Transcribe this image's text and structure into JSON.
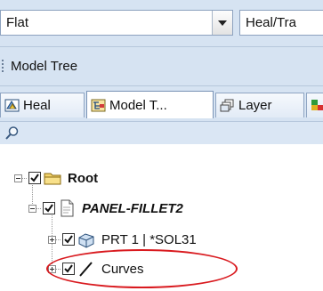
{
  "toolbar": {
    "mode_combo": {
      "value": "Flat",
      "icon": "chevron-down-icon"
    },
    "operation_combo": {
      "value": "Heal/Tra"
    }
  },
  "panel": {
    "title": "Model Tree"
  },
  "tabs": [
    {
      "label": "Heal",
      "icon": "heal-icon",
      "active": false
    },
    {
      "label": "Model T...",
      "icon": "model-tree-icon",
      "active": true
    },
    {
      "label": "Layer",
      "icon": "layer-icon",
      "active": false
    },
    {
      "label": "",
      "icon": "more-tab-icon",
      "active": false
    }
  ],
  "search": {
    "icon": "search-icon"
  },
  "tree": {
    "root": {
      "label": "Root",
      "checked": true,
      "expanded": true,
      "icon": "folder-icon"
    },
    "part": {
      "label": "PANEL-FILLET2",
      "checked": true,
      "expanded": true,
      "icon": "document-icon"
    },
    "prt": {
      "label": "PRT 1 | *SOL31",
      "checked": true,
      "expanded": false,
      "icon": "solid-part-icon"
    },
    "curves": {
      "label": "Curves",
      "checked": true,
      "expanded": false,
      "icon": "curve-icon"
    }
  },
  "annotation": {
    "highlight_color": "#d91a1f",
    "highlighted_item": "Curves"
  }
}
